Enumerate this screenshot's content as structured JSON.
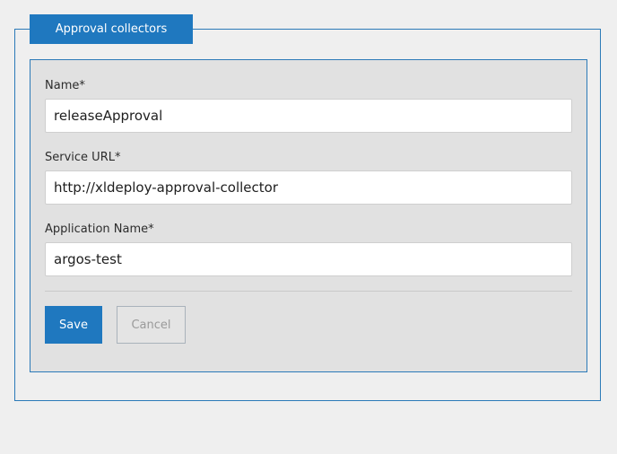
{
  "panel": {
    "tab_label": "Approval collectors"
  },
  "form": {
    "fields": [
      {
        "label": "Name*",
        "value": "releaseApproval"
      },
      {
        "label": "Service URL*",
        "value": "http://xldeploy-approval-collector"
      },
      {
        "label": "Application Name*",
        "value": "argos-test"
      }
    ],
    "save_label": "Save",
    "cancel_label": "Cancel"
  },
  "colors": {
    "accent": "#1f78bf",
    "panel_border": "#2b7ab8",
    "form_background": "#e1e1e1",
    "page_background": "#efefef"
  }
}
